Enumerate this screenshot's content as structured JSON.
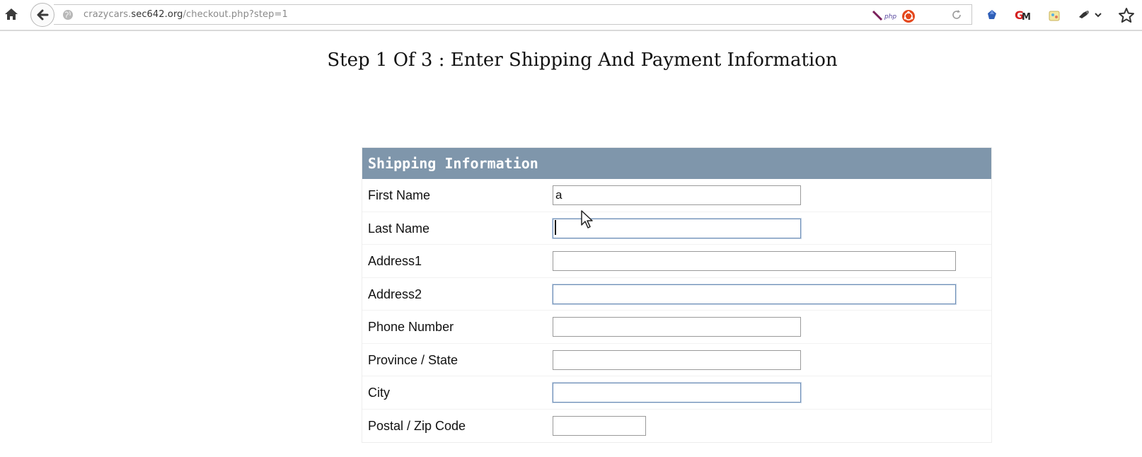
{
  "browser": {
    "url_prefix": "crazycars.",
    "url_domain": "sec642.org",
    "url_path": "/checkout.php?step=1",
    "icons": [
      "home-icon",
      "back-icon",
      "globe-icon",
      "php-extension-icon",
      "ubuntu-icon",
      "reload-icon",
      "extension-blue-icon",
      "greasemonkey-icon",
      "extension-bag-icon",
      "extension-tool-icon",
      "star-icon"
    ]
  },
  "page": {
    "title": "Step 1 Of 3 : Enter Shipping And Payment Information"
  },
  "shipping": {
    "header": "Shipping Information",
    "header_color": "#7f96ab",
    "fields": {
      "first_name": {
        "label": "First Name",
        "value": "a"
      },
      "last_name": {
        "label": "Last Name",
        "value": ""
      },
      "address1": {
        "label": "Address1",
        "value": ""
      },
      "address2": {
        "label": "Address2",
        "value": ""
      },
      "phone": {
        "label": "Phone Number",
        "value": ""
      },
      "province": {
        "label": "Province / State",
        "value": ""
      },
      "city": {
        "label": "City",
        "value": ""
      },
      "postal": {
        "label": "Postal / Zip Code",
        "value": ""
      }
    }
  }
}
